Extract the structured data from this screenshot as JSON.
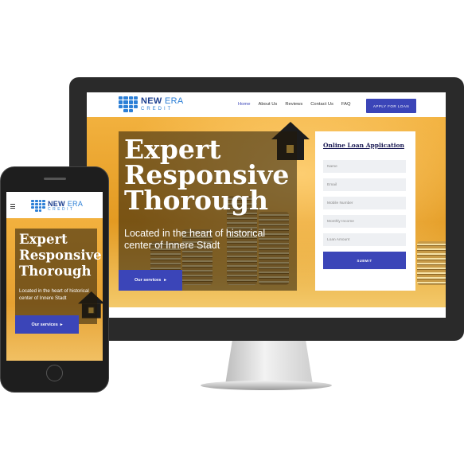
{
  "brand": {
    "name_part1": "NEW",
    "name_part2": "ERA",
    "sub": "CREDIT",
    "primary_color": "#3b45b8",
    "logo_color": "#2c7fd6"
  },
  "nav": {
    "items": [
      {
        "label": "Home",
        "active": true
      },
      {
        "label": "About Us",
        "active": false
      },
      {
        "label": "Reviews",
        "active": false
      },
      {
        "label": "Contact Us",
        "active": false
      },
      {
        "label": "FAQ",
        "active": false
      }
    ],
    "apply_label": "APPLY FOR LOAN"
  },
  "hero": {
    "heading_lines": [
      "Expert",
      "Responsive",
      "Thorough"
    ],
    "subtitle": "Located in the heart of historical center of Innere Stadt",
    "button_label": "Our services",
    "button_icon": "chevron-right-icon"
  },
  "form": {
    "title": "Online Loan Application",
    "fields": [
      {
        "placeholder": "Name"
      },
      {
        "placeholder": "Email"
      },
      {
        "placeholder": "Mobile Number"
      },
      {
        "placeholder": "Monthly Income"
      },
      {
        "placeholder": "Loan Amount"
      }
    ],
    "submit_label": "SUBMIT"
  },
  "mobile": {
    "menu_icon": "hamburger-icon"
  }
}
